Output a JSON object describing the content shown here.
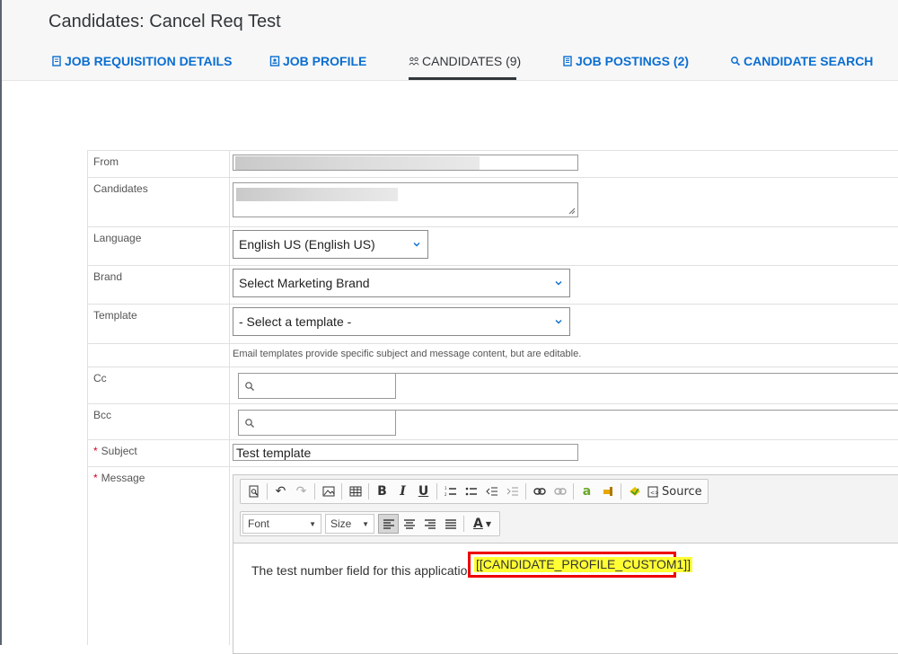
{
  "page": {
    "title": "Candidates: Cancel Req Test"
  },
  "tabs": [
    {
      "label": "JOB REQUISITION DETAILS",
      "icon": "document-icon"
    },
    {
      "label": "JOB PROFILE",
      "icon": "profile-icon"
    },
    {
      "label": "CANDIDATES (9)",
      "icon": "people-icon",
      "active": true
    },
    {
      "label": "JOB POSTINGS (2)",
      "icon": "postings-icon"
    },
    {
      "label": "CANDIDATE SEARCH",
      "icon": "search-icon"
    }
  ],
  "form": {
    "from_label": "From",
    "candidates_label": "Candidates",
    "language_label": "Language",
    "language_value": "English US (English US)",
    "brand_label": "Brand",
    "brand_value": "Select Marketing Brand",
    "template_label": "Template",
    "template_value": "- Select a template -",
    "template_hint": "Email templates provide specific subject and message content, but are editable.",
    "cc_label": "Cc",
    "bcc_label": "Bcc",
    "required_mark": "*",
    "subject_label": "Subject",
    "subject_value": "Test template",
    "message_label": "Message"
  },
  "editor": {
    "source_label": "Source",
    "font_label": "Font",
    "size_label": "Size",
    "bold": "B",
    "italic": "I",
    "underline": "U",
    "text_color": "A",
    "message_text": "The test number field for this application is ",
    "merge_token": "[[CANDIDATE_PROFILE_CUSTOM1]]"
  },
  "colors": {
    "link": "#0a6ed1",
    "highlight": "#ffff33",
    "annotation": "#ee0000"
  }
}
